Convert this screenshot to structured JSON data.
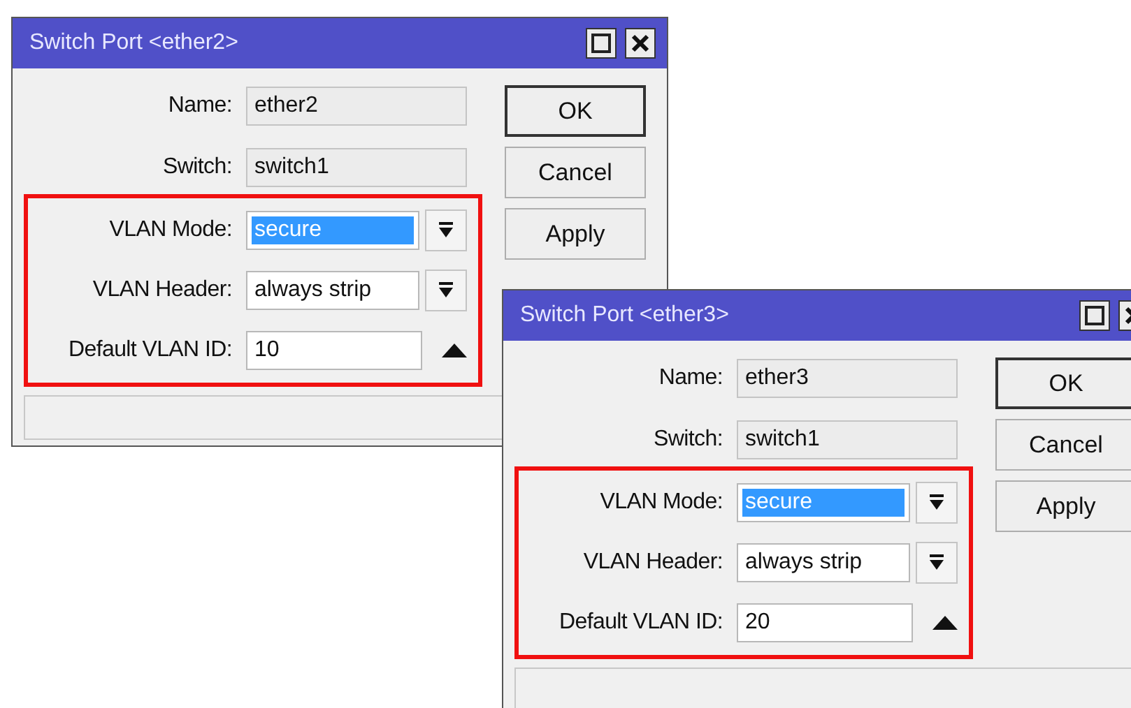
{
  "windows": [
    {
      "title": "Switch Port <ether2>",
      "fields": [
        {
          "label": "Name:",
          "value": "ether2",
          "kind": "text",
          "readonly": true,
          "highlighted": false,
          "outlined": false
        },
        {
          "label": "Switch:",
          "value": "switch1",
          "kind": "text",
          "readonly": true,
          "highlighted": false,
          "outlined": false
        },
        {
          "label": "VLAN Mode:",
          "value": "secure",
          "kind": "select",
          "readonly": false,
          "highlighted": true,
          "outlined": true
        },
        {
          "label": "VLAN Header:",
          "value": "always strip",
          "kind": "select",
          "readonly": false,
          "highlighted": false,
          "outlined": true
        },
        {
          "label": "Default VLAN ID:",
          "value": "10",
          "kind": "number",
          "readonly": false,
          "highlighted": false,
          "outlined": true
        }
      ],
      "buttons": [
        {
          "label": "OK",
          "default": true
        },
        {
          "label": "Cancel",
          "default": false
        },
        {
          "label": "Apply",
          "default": false
        }
      ]
    },
    {
      "title": "Switch Port <ether3>",
      "fields": [
        {
          "label": "Name:",
          "value": "ether3",
          "kind": "text",
          "readonly": true,
          "highlighted": false,
          "outlined": false
        },
        {
          "label": "Switch:",
          "value": "switch1",
          "kind": "text",
          "readonly": true,
          "highlighted": false,
          "outlined": false
        },
        {
          "label": "VLAN Mode:",
          "value": "secure",
          "kind": "select",
          "readonly": false,
          "highlighted": true,
          "outlined": true
        },
        {
          "label": "VLAN Header:",
          "value": "always strip",
          "kind": "select",
          "readonly": false,
          "highlighted": false,
          "outlined": true
        },
        {
          "label": "Default VLAN ID:",
          "value": "20",
          "kind": "number",
          "readonly": false,
          "highlighted": false,
          "outlined": true
        }
      ],
      "buttons": [
        {
          "label": "OK",
          "default": true
        },
        {
          "label": "Cancel",
          "default": false
        },
        {
          "label": "Apply",
          "default": false
        }
      ]
    }
  ]
}
